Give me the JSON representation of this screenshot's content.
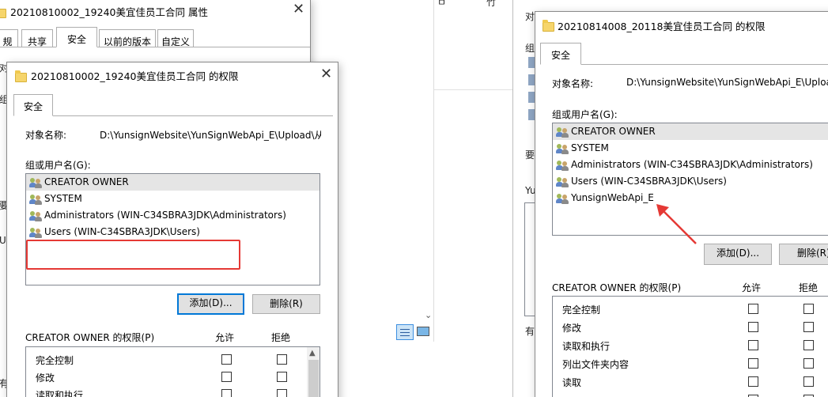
{
  "back_window": {
    "title": "20210810002_19240美宜佳员工合同 属性",
    "tabs": [
      "规",
      "共享",
      "安全",
      "以前的版本",
      "自定义"
    ],
    "side_fragments": [
      "对",
      "组",
      "要",
      "U",
      "有"
    ]
  },
  "left_dialog": {
    "title": "20210810002_19240美宜佳员工合同 的权限",
    "tab": "安全",
    "object_label": "对象名称:",
    "object_value": "D:\\YunsignWebsite\\YunSignWebApi_E\\Upload\\从",
    "group_label": "组或用户名(G):",
    "users": [
      "CREATOR OWNER",
      "SYSTEM",
      "Administrators (WIN-C34SBRA3JDK\\Administrators)",
      "Users (WIN-C34SBRA3JDK\\Users)"
    ],
    "add_button": "添加(D)...",
    "remove_button": "删除(R)",
    "perm_header": "CREATOR OWNER 的权限(P)",
    "allow_header": "允许",
    "deny_header": "拒绝",
    "permissions": [
      "完全控制",
      "修改",
      "读取和执行"
    ]
  },
  "right_dialog": {
    "title": "20210814008_20118美宜佳员工合同 的权限",
    "tab": "安全",
    "object_label": "对象名称:",
    "object_value": "D:\\YunsignWebsite\\YunSignWebApi_E\\Upload",
    "group_label": "组或用户名(G):",
    "users": [
      "CREATOR OWNER",
      "SYSTEM",
      "Administrators (WIN-C34SBRA3JDK\\Administrators)",
      "Users (WIN-C34SBRA3JDK\\Users)",
      "YunsignWebApi_E"
    ],
    "add_button": "添加(D)...",
    "remove_button": "删除(R)",
    "perm_header": "CREATOR OWNER 的权限(P)",
    "allow_header": "允许",
    "deny_header": "拒绝",
    "permissions": [
      "完全控制",
      "修改",
      "读取和执行",
      "列出文件夹内容",
      "读取"
    ],
    "side_fragments": [
      "对",
      "组",
      "要",
      "Yu",
      "有"
    ]
  },
  "middle_fragments": [
    "ㅁ",
    "竹"
  ],
  "colors": {
    "highlight_red": "#e53935",
    "accent_blue": "#0078d7"
  }
}
